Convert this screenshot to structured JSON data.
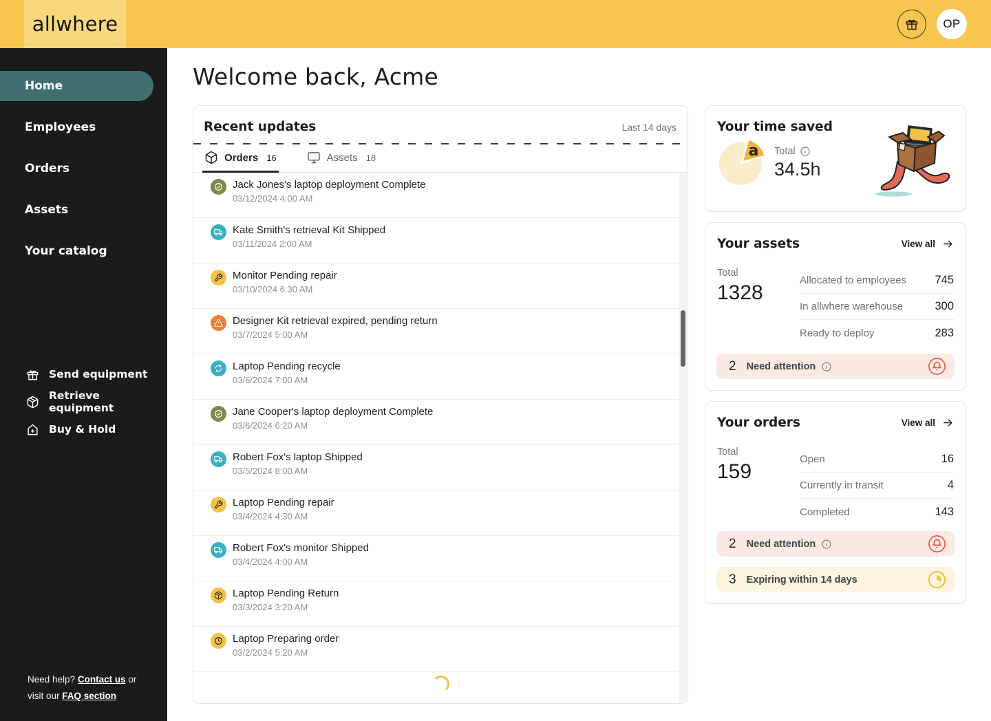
{
  "brand": {
    "logo_text": "allwhere",
    "header_bg": "#F6C64F",
    "logo_bg": "#F8D77D"
  },
  "header": {
    "gift_icon": "gift-icon",
    "avatar_initials": "OP"
  },
  "sidebar": {
    "items": [
      {
        "label": "Home",
        "active": true,
        "chevron": false
      },
      {
        "label": "Employees",
        "active": false,
        "chevron": false
      },
      {
        "label": "Orders",
        "active": false,
        "chevron": true
      },
      {
        "label": "Assets",
        "active": false,
        "chevron": true
      },
      {
        "label": "Your catalog",
        "active": false,
        "chevron": false
      }
    ],
    "actions": [
      {
        "icon": "gift-icon",
        "label": "Send equipment"
      },
      {
        "icon": "package-icon",
        "label": "Retrieve equipment"
      },
      {
        "icon": "home-plus-icon",
        "label": "Buy & Hold"
      }
    ],
    "help": {
      "text_before": "Need help?",
      "contact_link": "Contact us",
      "text_middle": "or visit our",
      "faq_link": "FAQ section"
    }
  },
  "main": {
    "welcome_title": "Welcome back, Acme",
    "recent_updates": {
      "title": "Recent updates",
      "range_label": "Last 14 days",
      "tabs": [
        {
          "label": "Orders",
          "count": "16",
          "icon": "cube-icon",
          "active": true
        },
        {
          "label": "Assets",
          "count": "18",
          "icon": "monitor-icon",
          "active": false
        }
      ],
      "items": [
        {
          "icon": "check-circle-icon",
          "color": "#7C8B49",
          "title": "Jack Jones's laptop deployment Complete",
          "timestamp": "03/12/2024 4:00 AM"
        },
        {
          "icon": "truck-icon",
          "color": "#3BAFC3",
          "title": "Kate Smith's retrieval Kit Shipped",
          "timestamp": "03/11/2024 2:00 AM"
        },
        {
          "icon": "wrench-icon",
          "color": "#F4C246",
          "title": "Monitor Pending repair",
          "timestamp": "03/10/2024 6:30 AM"
        },
        {
          "icon": "alert-triangle-icon",
          "color": "#ED7E35",
          "title": "Designer Kit retrieval expired, pending return",
          "timestamp": "03/7/2024 5:00 AM"
        },
        {
          "icon": "recycle-icon",
          "color": "#3BAFC3",
          "title": "Laptop Pending recycle",
          "timestamp": "03/6/2024 7:00 AM"
        },
        {
          "icon": "check-circle-icon",
          "color": "#7C8B49",
          "title": "Jane Cooper's laptop deployment Complete",
          "timestamp": "03/6/2024 6:20 AM"
        },
        {
          "icon": "truck-icon",
          "color": "#3BAFC3",
          "title": "Robert Fox's laptop Shipped",
          "timestamp": "03/5/2024 8:00 AM"
        },
        {
          "icon": "wrench-icon",
          "color": "#F4C246",
          "title": "Laptop Pending repair",
          "timestamp": "03/4/2024 4:30 AM"
        },
        {
          "icon": "truck-icon",
          "color": "#3BAFC3",
          "title": "Robert Fox's monitor Shipped",
          "timestamp": "03/4/2024 4:00 AM"
        },
        {
          "icon": "package-icon",
          "color": "#F4C246",
          "title": "Laptop Pending Return",
          "timestamp": "03/3/2024 3:20 AM"
        },
        {
          "icon": "clock-icon",
          "color": "#F4C246",
          "title": "Laptop Preparing order",
          "timestamp": "03/2/2024 5:20 AM"
        }
      ]
    }
  },
  "cards": {
    "time_saved": {
      "title": "Your time saved",
      "total_label": "Total",
      "info_icon": "info-icon",
      "value": "34.5h",
      "pie_main_color": "#FAEBC9",
      "pie_wedge_color": "#F0B441",
      "pie_letter": "a"
    },
    "assets": {
      "title": "Your assets",
      "view_all_label": "View all",
      "total_label": "Total",
      "total": "1328",
      "rows": [
        {
          "label": "Allocated to employees",
          "value": "745"
        },
        {
          "label": "In allwhere warehouse",
          "value": "300"
        },
        {
          "label": "Ready to deploy",
          "value": "283"
        }
      ],
      "alerts": [
        {
          "count": "2",
          "label": "Need attention",
          "info": true,
          "icon": "bell-icon",
          "bg": "#FBE9E6",
          "icon_color": "#E45B45"
        }
      ]
    },
    "orders": {
      "title": "Your orders",
      "view_all_label": "View all",
      "total_label": "Total",
      "total": "159",
      "rows": [
        {
          "label": "Open",
          "value": "16"
        },
        {
          "label": "Currently in transit",
          "value": "4"
        },
        {
          "label": "Completed",
          "value": "143"
        }
      ],
      "alerts": [
        {
          "count": "2",
          "label": "Need attention",
          "info": true,
          "icon": "bell-icon",
          "bg": "#FBE9E6",
          "icon_color": "#E45B45"
        },
        {
          "count": "3",
          "label": "Expiring within 14 days",
          "info": false,
          "icon": "timer-icon",
          "bg": "#FCF4DE",
          "icon_color": "#EFBE3F"
        }
      ]
    }
  }
}
